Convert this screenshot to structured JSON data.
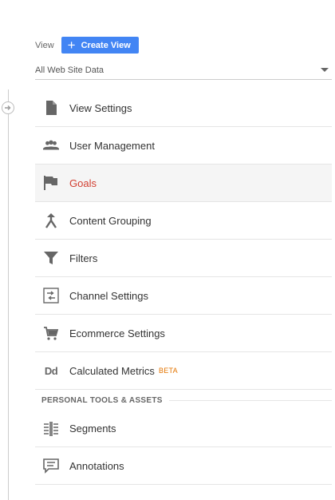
{
  "view": {
    "label": "View",
    "create_button": "Create View",
    "selected": "All Web Site Data"
  },
  "menu": {
    "items": [
      {
        "label": "View Settings",
        "icon": "document-icon"
      },
      {
        "label": "User Management",
        "icon": "people-icon"
      },
      {
        "label": "Goals",
        "icon": "flag-icon",
        "active": true
      },
      {
        "label": "Content Grouping",
        "icon": "merge-icon"
      },
      {
        "label": "Filters",
        "icon": "filter-icon"
      },
      {
        "label": "Channel Settings",
        "icon": "channel-icon"
      },
      {
        "label": "Ecommerce Settings",
        "icon": "cart-icon"
      },
      {
        "label": "Calculated Metrics",
        "icon": "dd-icon",
        "badge": "BETA"
      }
    ],
    "section_title": "PERSONAL TOOLS & ASSETS",
    "personal_items": [
      {
        "label": "Segments",
        "icon": "segments-icon"
      },
      {
        "label": "Annotations",
        "icon": "annotation-icon"
      }
    ]
  },
  "icon_glyphs": {
    "dd": "Dd"
  },
  "colors": {
    "accent": "#4285f4",
    "active_text": "#d23f31",
    "beta": "#e37400",
    "icon": "#666666"
  }
}
